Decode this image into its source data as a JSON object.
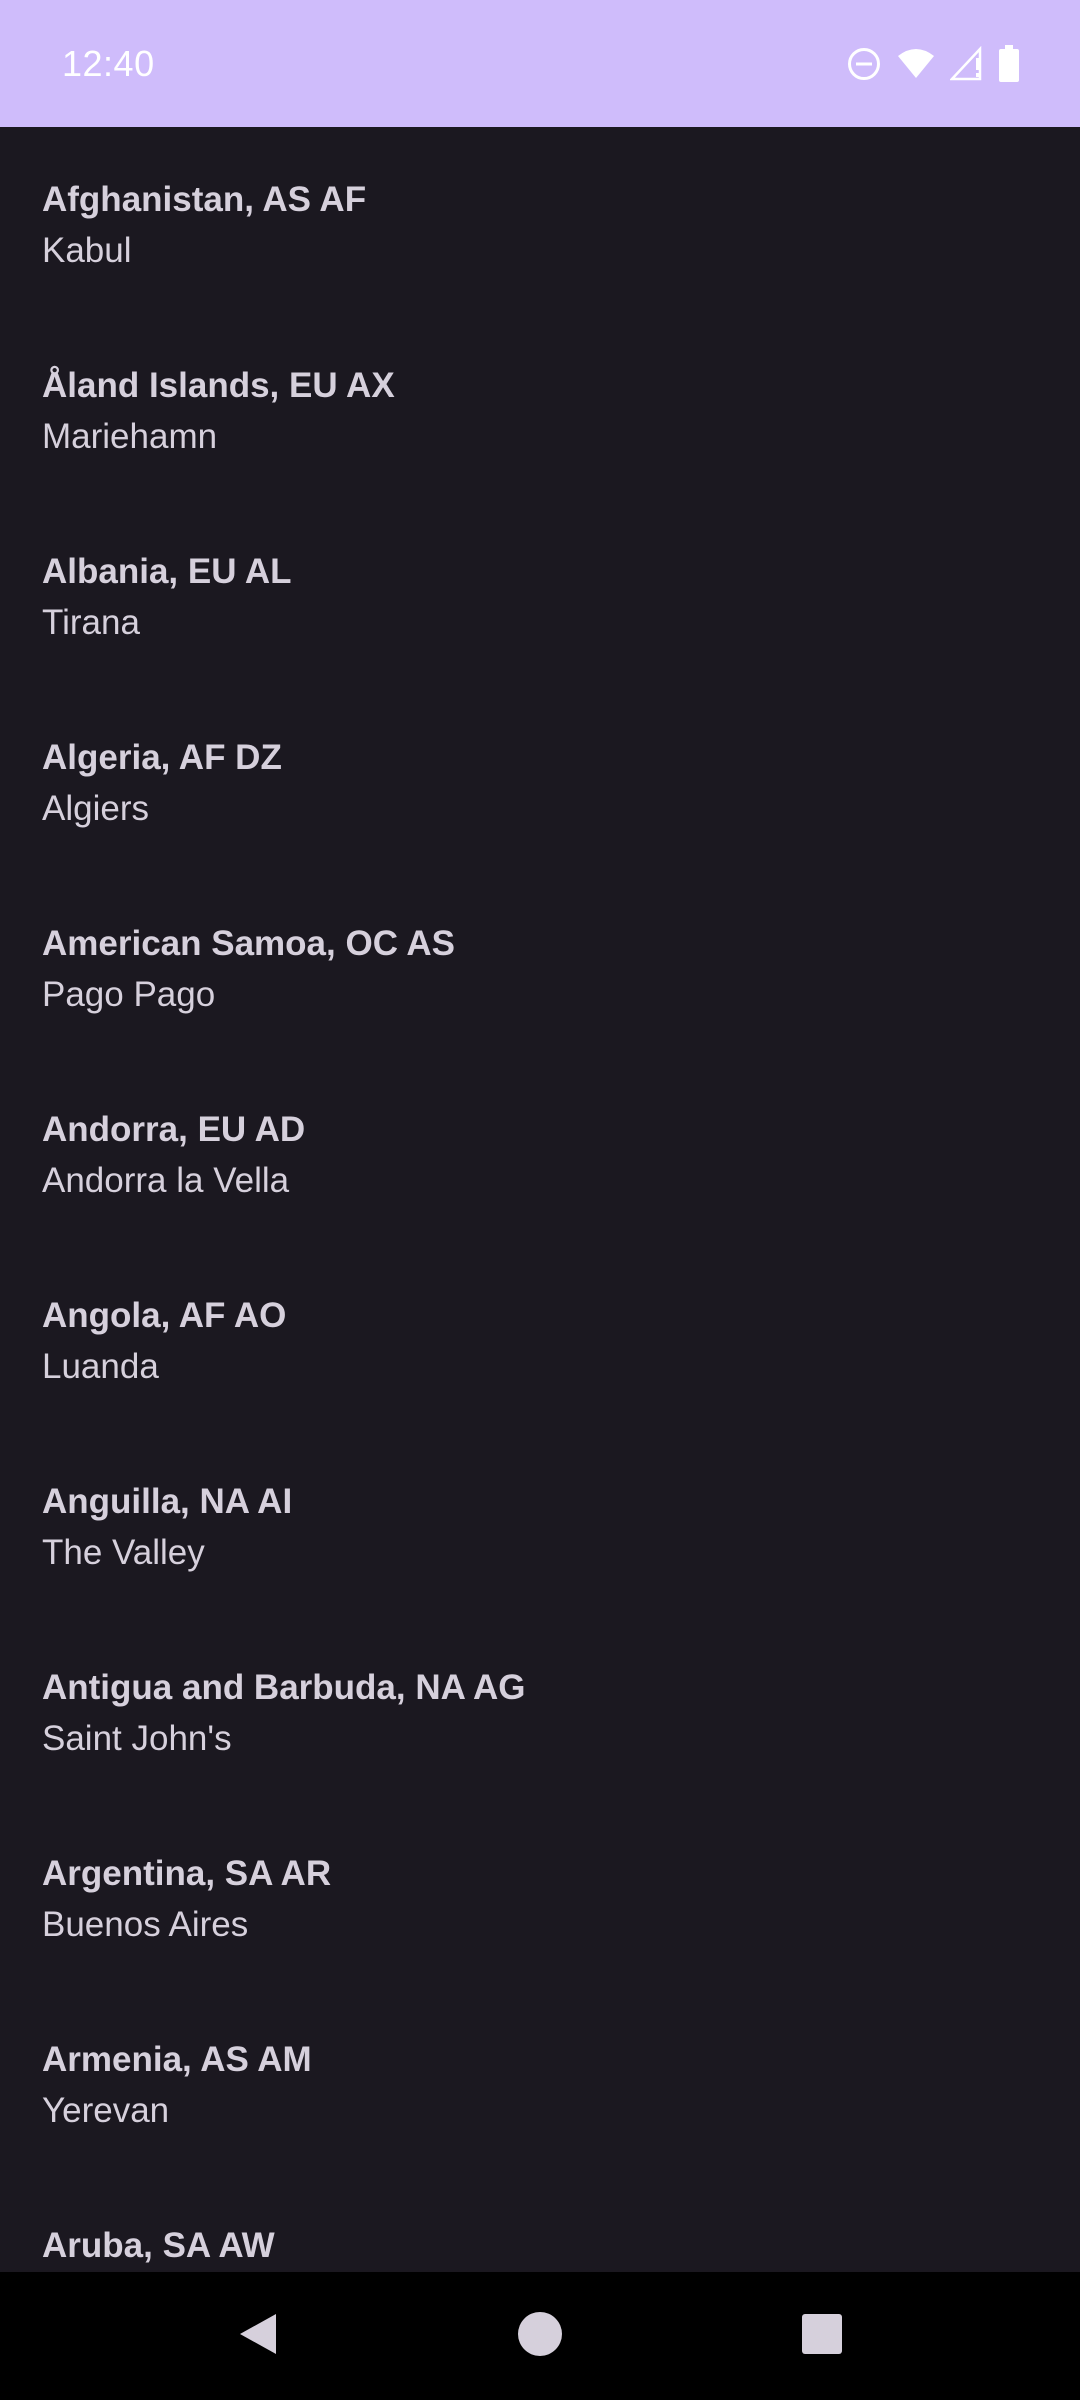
{
  "status_bar": {
    "time": "12:40",
    "icons": [
      "do-not-disturb-icon",
      "wifi-icon",
      "cellular-no-signal-icon",
      "battery-icon"
    ],
    "background": "#cfbcfb"
  },
  "countries": [
    {
      "title": "Afghanistan, AS AF",
      "capital": "Kabul"
    },
    {
      "title": "Åland Islands, EU AX",
      "capital": "Mariehamn"
    },
    {
      "title": "Albania, EU AL",
      "capital": "Tirana"
    },
    {
      "title": "Algeria, AF DZ",
      "capital": "Algiers"
    },
    {
      "title": "American Samoa, OC AS",
      "capital": "Pago Pago"
    },
    {
      "title": "Andorra, EU AD",
      "capital": "Andorra la Vella"
    },
    {
      "title": "Angola, AF AO",
      "capital": "Luanda"
    },
    {
      "title": "Anguilla, NA AI",
      "capital": "The Valley"
    },
    {
      "title": "Antigua and Barbuda, NA AG",
      "capital": "Saint John's"
    },
    {
      "title": "Argentina, SA AR",
      "capital": "Buenos Aires"
    },
    {
      "title": "Armenia, AS AM",
      "capital": "Yerevan"
    },
    {
      "title": "Aruba, SA AW",
      "capital": ""
    }
  ],
  "nav_bar": {
    "icons": [
      "back-icon",
      "home-icon",
      "recents-icon"
    ]
  },
  "colors": {
    "background": "#1b1820",
    "text": "#d6d0dc",
    "nav_background": "#000000"
  }
}
